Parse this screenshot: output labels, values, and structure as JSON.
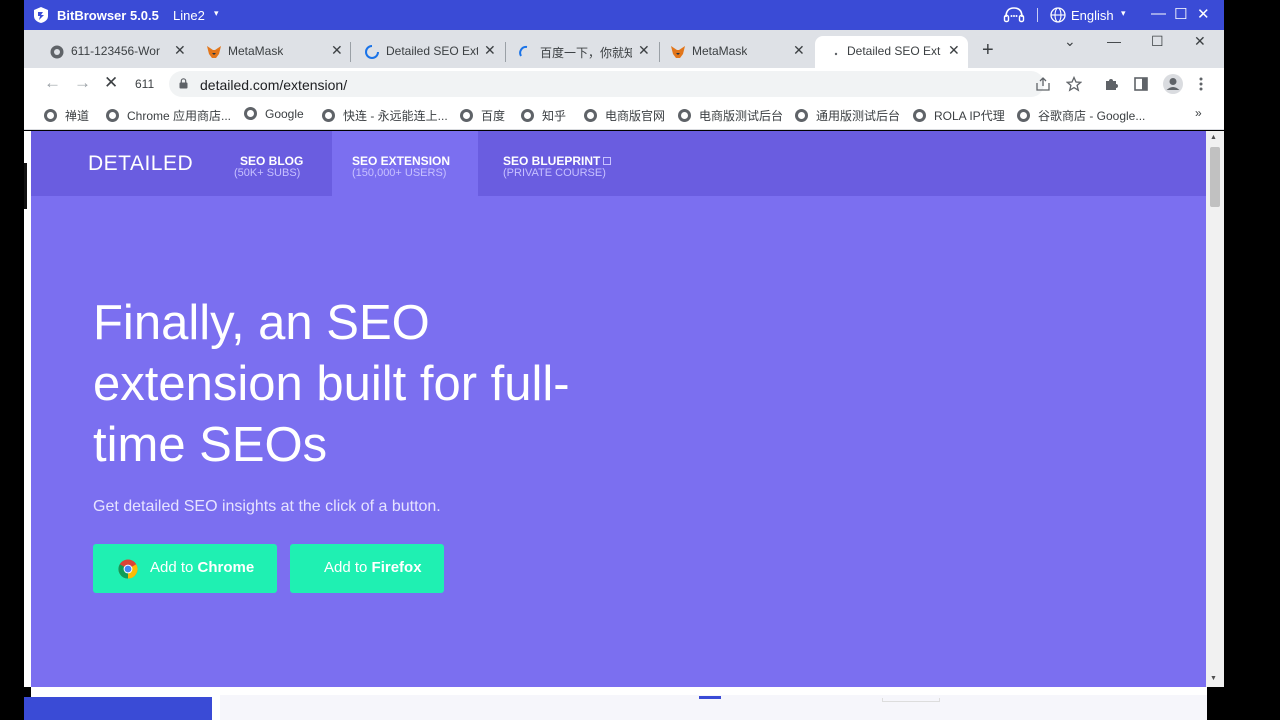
{
  "bitbrowser": {
    "title": "BitBrowser 5.0.5",
    "profile": "Line2",
    "language": "English",
    "caret": "▾",
    "minimize": "—",
    "maximize": "☐",
    "close": "✕"
  },
  "tabs": [
    {
      "title": "611-123456-Wor",
      "icon": "globe-icon"
    },
    {
      "title": "MetaMask",
      "icon": "metamask-icon"
    },
    {
      "title": "Detailed SEO Ext",
      "icon": "loading-icon"
    },
    {
      "title": "百度一下，你就知",
      "icon": "loading-icon"
    },
    {
      "title": "MetaMask",
      "icon": "metamask-icon"
    },
    {
      "title": "Detailed SEO Ext",
      "icon": "loading-dot-icon",
      "active": true
    }
  ],
  "tab_close": "✕",
  "new_tab": "+",
  "window_controls": {
    "dropdown": "⌄",
    "minimize": "—",
    "maximize": "☐",
    "close": "✕"
  },
  "toolbar": {
    "back": "←",
    "forward": "→",
    "stop": "✕",
    "tab_number": "611",
    "url": "detailed.com/extension/"
  },
  "bookmarks": [
    "禅道",
    "Chrome 应用商店...",
    "Google",
    "快连 - 永远能连上...",
    "百度",
    "知乎",
    "电商版官网",
    "电商版测试后台",
    "通用版测试后台",
    "ROLA IP代理",
    "谷歌商店 - Google..."
  ],
  "bookmarks_more": "»",
  "site": {
    "logo": "DETAILED",
    "nav": [
      {
        "title": "SEO BLOG",
        "sub": "(50K+ SUBS)"
      },
      {
        "title": "SEO EXTENSION",
        "sub": "(150,000+ USERS)",
        "active": true
      },
      {
        "title": "SEO BLUEPRINT",
        "sub": "(PRIVATE COURSE)",
        "external": true
      }
    ],
    "hero_title": "Finally, an SEO extension built for full-time SEOs",
    "hero_line1": "Finally, an SEO",
    "hero_line2": "extension built for full-",
    "hero_line3": "time SEOs",
    "hero_subtitle": "Get detailed SEO insights at the click of a button.",
    "cta_chrome_prefix": "Add to ",
    "cta_chrome_bold": "Chrome",
    "cta_firefox_prefix": "Add to ",
    "cta_firefox_bold": "Firefox"
  },
  "colors": {
    "bitbrowser_bar": "#3a4bd6",
    "site_nav": "#6a5de0",
    "hero_bg": "#7b6ff0",
    "cta": "#1ff0b2"
  }
}
